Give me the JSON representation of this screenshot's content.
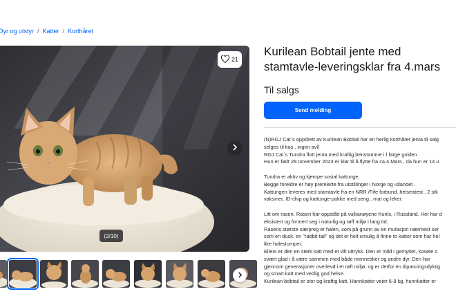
{
  "breadcrumb": [
    {
      "label": "Dyr og utstyr"
    },
    {
      "label": "Katter"
    },
    {
      "label": "Korthåret"
    }
  ],
  "gallery": {
    "favorite_count": "21",
    "counter": "(2/10)"
  },
  "listing": {
    "title_line1": "Kurilean Bobtail jente med",
    "title_line2": "stamtavle-leveringsklar fra 4.mars",
    "status": "Til salgs",
    "cta_label": "Send melding"
  },
  "description": [
    "(N)RGJ Cat´s oppdrett av Kurilean Bobtail har en herlig korthåret  jenta til salg",
    "selges til kos , ingen avl)",
    "RGJ Cat´s Tundra  flott  jenta med kraftig benstamme i  l farge golden .",
    " Hun er født 28.november 2023 er klar til å flytte fra ca 4.Mars , da hun er 14 u",
    "",
    "Tundra er aktiv og kjempe sosial kattunge.",
    "Begge foreldre er  høy premierte fra utstillinger i Norge og utlandet .",
    "Kattungen leveres med stamtavle fra en NRR /Fife forbund, helseatest , 2 stk",
    "vaksiner, ID-chip og kattunge-pakke med seng , mat og leker.",
    "",
    " Litt om rasen. Rasen har oppstått på vulkanøyene Kurils, i Russland. Her har d",
    "eksistert og formert seg i naturlig og røff miljø i lang tid.",
    " Rasens største særpreg er halen, som på grunn av en mutasjon nærmest ser",
    "som en dusk, en \"rabbit tail\" og det er helt umulig å finne to katter som har hel",
    "like halestumper.",
    " Ellers er den en sterk katt med et vilt uttrykk. Den er mild i gemyttet, kosete o",
    "svært glad i å være sammen med både mennesker og andre dyr. Den har",
    "gjennom generasjoner overlevd i et røft miljø, og er derfor en tilpasningsdyktig",
    "og smart katt med vedlig god helse.",
    " Kurilean bobtail er stor og kraftig katt. Hannkatter veier 6-8 kg, hunnkatter er"
  ],
  "colors": {
    "accent": "#0063fb",
    "text": "#1b1b1f"
  },
  "icons": [
    "heart-icon",
    "chevron-right-icon"
  ]
}
